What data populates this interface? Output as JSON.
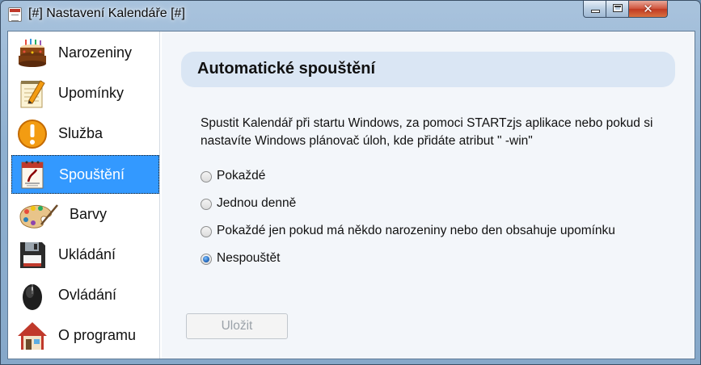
{
  "window": {
    "title": "[#] Nastavení Kalendáře [#]",
    "close_symbol": "✕"
  },
  "sidebar": {
    "items": [
      {
        "label": "Narozeniny",
        "icon": "birthday-cake-icon"
      },
      {
        "label": "Upomínky",
        "icon": "notepad-pencil-icon"
      },
      {
        "label": "Služba",
        "icon": "exclamation-icon"
      },
      {
        "label": "Spouštění",
        "icon": "calendar-launch-icon",
        "selected": true
      },
      {
        "label": "Barvy",
        "icon": "paint-palette-icon"
      },
      {
        "label": "Ukládání",
        "icon": "floppy-disk-icon"
      },
      {
        "label": "Ovládání",
        "icon": "mouse-icon"
      },
      {
        "label": "O programu",
        "icon": "house-icon"
      }
    ]
  },
  "main": {
    "header": "Automatické spouštění",
    "description": "Spustit Kalendář při startu Windows, za pomoci STARTzjs aplikace nebo pokud si nastavíte Windows plánovač úloh, kde přidáte atribut \" -win\"",
    "options": [
      {
        "label": "Pokaždé",
        "checked": false
      },
      {
        "label": "Jednou denně",
        "checked": false
      },
      {
        "label": "Pokaždé jen pokud má někdo narozeniny nebo den obsahuje upomínku",
        "checked": false
      },
      {
        "label": "Nespouštět",
        "checked": true
      }
    ],
    "save_label": "Uložit"
  },
  "colors": {
    "selection": "#3399ff",
    "header_bar": "#dae6f4",
    "content_bg": "#f3f6fa"
  }
}
